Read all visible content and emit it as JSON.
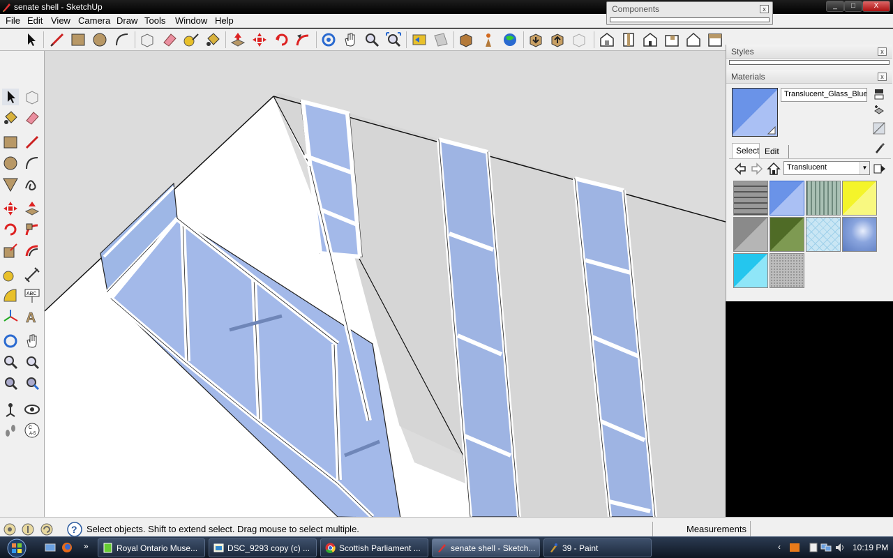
{
  "window": {
    "title": "senate shell - SketchUp",
    "min_label": "_",
    "max_label": "□",
    "close_label": "X"
  },
  "menu": [
    "File",
    "Edit",
    "View",
    "Camera",
    "Draw",
    "Tools",
    "Window",
    "Help"
  ],
  "components_panel": {
    "title": "Components",
    "close_label": "x"
  },
  "styles_panel": {
    "title": "Styles",
    "close_label": "x"
  },
  "materials_panel": {
    "title": "Materials",
    "close_label": "x",
    "material_name": "Translucent_Glass_Blue",
    "tabs": {
      "select": "Select",
      "edit": "Edit"
    },
    "collection": "Translucent",
    "swatches": [
      {
        "name": "metal-mesh",
        "color": "#7a7a7a"
      },
      {
        "name": "glass-blue",
        "color": "#6a93e8"
      },
      {
        "name": "glass-green-ribbed",
        "color": "#8fa69a"
      },
      {
        "name": "glass-yellow",
        "color": "#f4f42a"
      },
      {
        "name": "glass-gray",
        "color": "#8a8a8a"
      },
      {
        "name": "glass-olive",
        "color": "#4f6b26"
      },
      {
        "name": "glass-cyan-grid",
        "color": "#c9e6f4"
      },
      {
        "name": "glass-sky",
        "color": "#5b7bc0"
      },
      {
        "name": "glass-cyan",
        "color": "#24c6ee"
      },
      {
        "name": "glass-frosted",
        "color": "#bdbdbd"
      }
    ]
  },
  "status": {
    "message": "Select objects. Shift to extend select. Drag mouse to select multiple.",
    "measurements_label": "Measurements"
  },
  "taskbar": {
    "tasks": [
      {
        "label": "Royal Ontario Muse...",
        "icon": "document-icon"
      },
      {
        "label": "DSC_9293 copy (c) ...",
        "icon": "image-icon"
      },
      {
        "label": "Scottish Parliament ...",
        "icon": "chrome-icon"
      },
      {
        "label": "senate shell - Sketch...",
        "icon": "sketchup-icon"
      },
      {
        "label": "39 - Paint",
        "icon": "paint-icon"
      }
    ],
    "clock": "10:19 PM"
  }
}
